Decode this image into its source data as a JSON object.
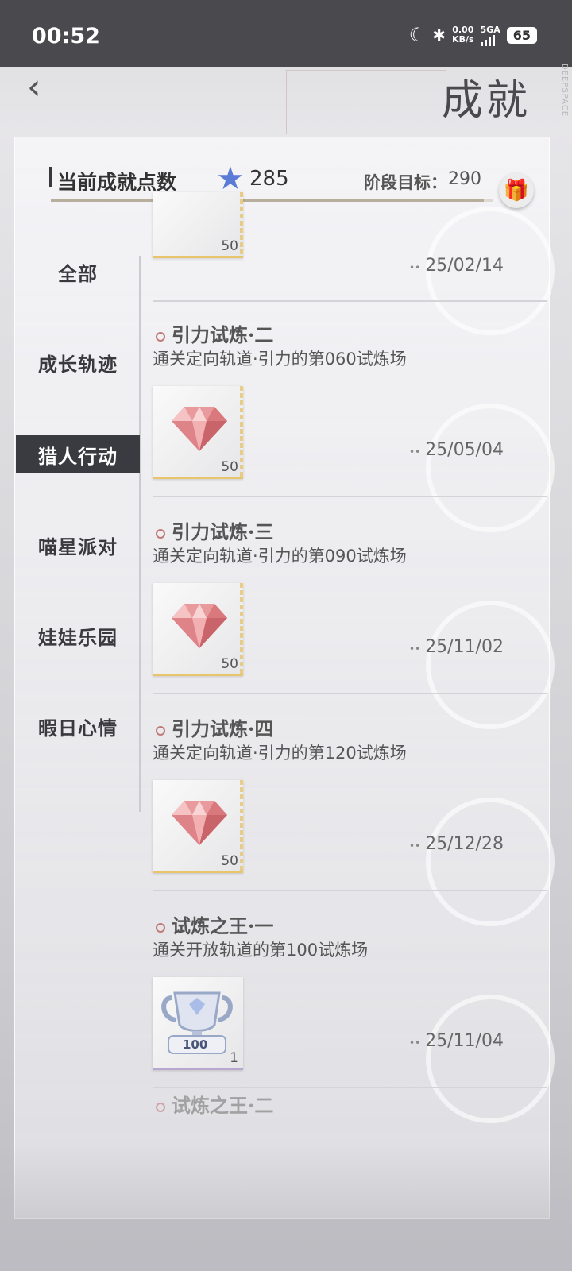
{
  "status": {
    "time": "00:52",
    "net_speed": "0.00",
    "net_unit": "KB/s",
    "net_type": "5GA",
    "battery": "65"
  },
  "header": {
    "back_icon": "chevron-left-icon",
    "title": "成就",
    "brand": "DEEPSPACE"
  },
  "points": {
    "label": "当前成就点数",
    "value": "285",
    "goal_label": "阶段目标：",
    "goal_value": "290",
    "progress": 0.98
  },
  "sidebar": {
    "items": [
      {
        "label": "全部"
      },
      {
        "label": "成长轨迹"
      },
      {
        "label": "猎人行动"
      },
      {
        "label": "喵星派对"
      },
      {
        "label": "娃娃乐园"
      },
      {
        "label": "暇日心情"
      }
    ],
    "active_index": 2
  },
  "achievements": [
    {
      "title": "",
      "desc": "",
      "qty": "50",
      "date": "25/02/14",
      "reward": "pink-gem-icon"
    },
    {
      "title": "引力试炼·二",
      "desc": "通关定向轨道·引力的第060试炼场",
      "qty": "50",
      "date": "25/05/04",
      "reward": "pink-gem-icon"
    },
    {
      "title": "引力试炼·三",
      "desc": "通关定向轨道·引力的第090试炼场",
      "qty": "50",
      "date": "25/11/02",
      "reward": "pink-gem-icon"
    },
    {
      "title": "引力试炼·四",
      "desc": "通关定向轨道·引力的第120试炼场",
      "qty": "50",
      "date": "25/12/28",
      "reward": "pink-gem-icon"
    },
    {
      "title": "试炼之王·一",
      "desc": "通关开放轨道的第100试炼场",
      "qty": "1",
      "date": "25/11/04",
      "reward": "trophy-icon",
      "trophy_label": "100"
    },
    {
      "title": "试炼之王·二"
    }
  ]
}
